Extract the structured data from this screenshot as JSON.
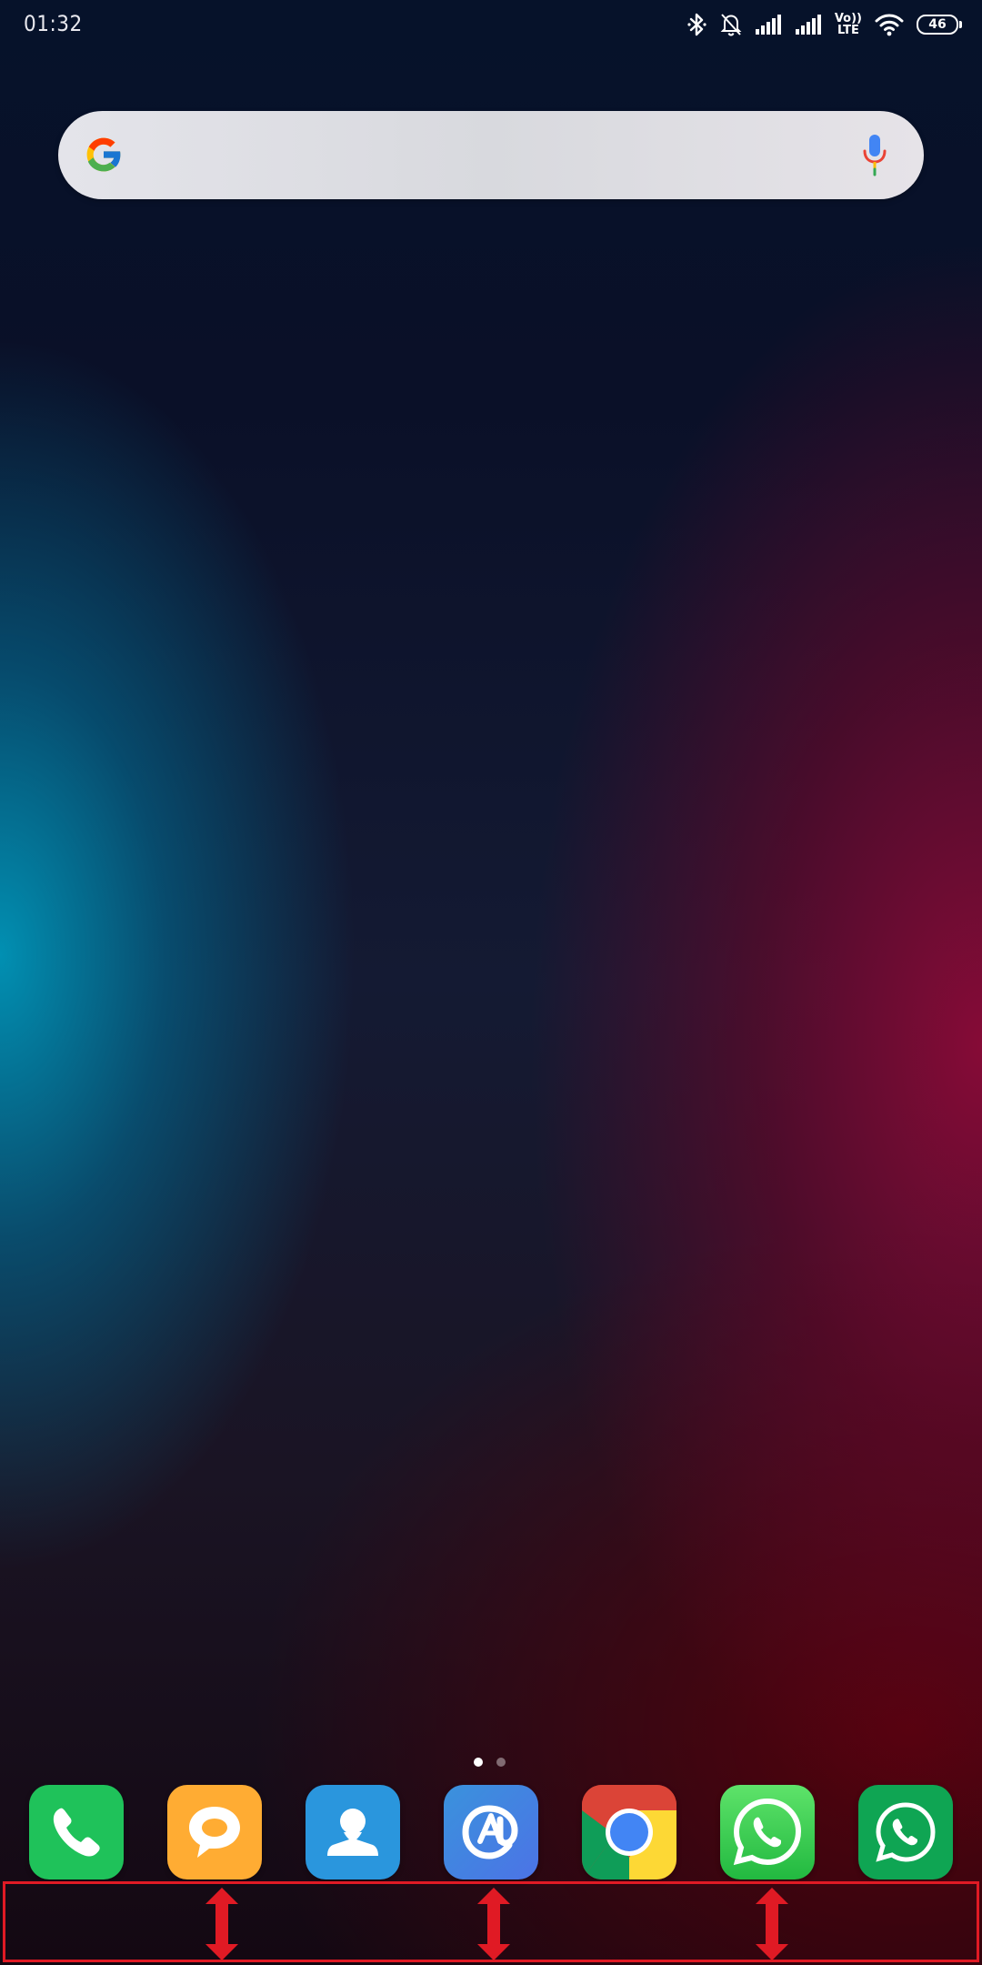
{
  "status_bar": {
    "time": "01:32",
    "icons": [
      "bluetooth-icon",
      "bell-off-icon",
      "signal-1-icon",
      "signal-2-icon",
      "volte-icon",
      "wifi-icon",
      "battery-icon"
    ],
    "volte_top": "Vo))",
    "volte_bottom": "LTE",
    "battery_level": "46"
  },
  "search_bar": {
    "icons": [
      "google-g-icon",
      "mic-icon"
    ]
  },
  "home": {
    "page_count": 2,
    "active_page": 0
  },
  "dock": {
    "apps": [
      {
        "icon": "phone-icon",
        "color": "#1fc25a"
      },
      {
        "icon": "messaging-icon",
        "color": "#ffac33"
      },
      {
        "icon": "contacts-icon",
        "color": "#2a96dd"
      },
      {
        "icon": "email-icon",
        "color": "#3b7ee0"
      },
      {
        "icon": "chrome-icon",
        "color": "#4285f4"
      },
      {
        "icon": "whatsapp-icon",
        "color": "#2fc84d"
      },
      {
        "icon": "whatsapp-business-icon",
        "color": "#0fa553"
      }
    ]
  },
  "gesture_area": {
    "border_color": "#e01a24",
    "arrows": [
      "swipe-up-down-arrow-left",
      "swipe-up-down-arrow-center",
      "swipe-up-down-arrow-right"
    ]
  }
}
